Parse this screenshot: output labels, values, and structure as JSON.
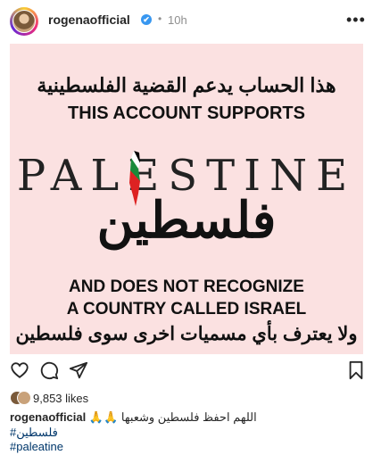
{
  "header": {
    "username": "rogenaofficial",
    "verified_icon": "✔",
    "separator": "•",
    "time": "10h",
    "more_icon": "•••"
  },
  "post": {
    "arabic_top": "هذا الحساب يدعم القضية الفلسطينية",
    "english_top": "THIS ACCOUNT SUPPORTS",
    "palestine_latin": "PALESTINE",
    "palestine_arabic": "فلسطين",
    "english_line1": "AND DOES NOT RECOGNIZE",
    "english_line2": "A COUNTRY CALLED ISRAEL",
    "arabic_bottom": "ولا يعترف بأي مسميات اخرى سوى فلسطين",
    "background_color": "#fbe1e1"
  },
  "actions": {
    "like_icon": "heart-icon",
    "comment_icon": "comment-icon",
    "share_icon": "share-icon",
    "save_icon": "bookmark-icon"
  },
  "likes": "9,853 likes",
  "caption": {
    "username": "rogenaofficial",
    "text": "🙏🙏 اللهم احفظ فلسطين وشعبها",
    "hashtags": [
      "#فلسطين",
      "#paleatine"
    ]
  }
}
